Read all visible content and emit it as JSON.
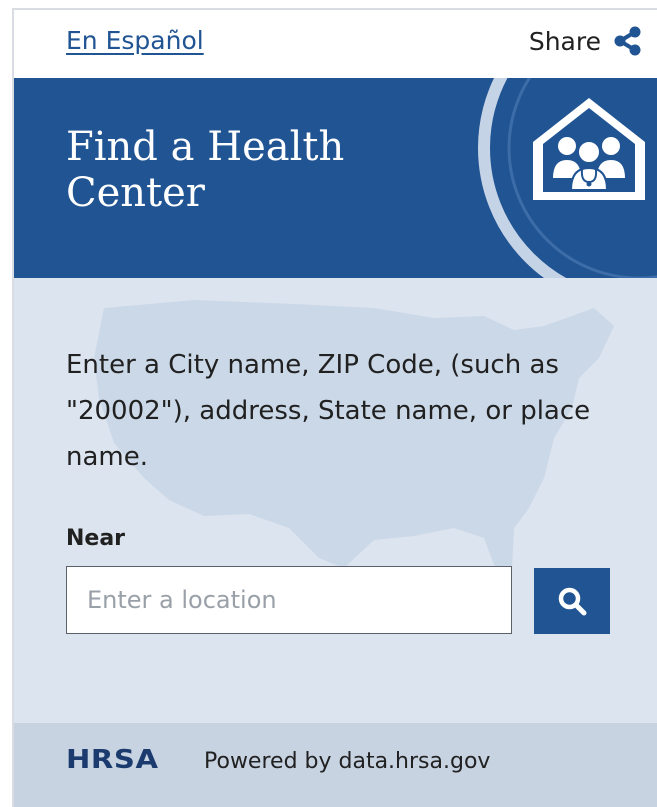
{
  "topbar": {
    "language_link": "En Español",
    "share_label": "Share",
    "share_icon": "share-icon"
  },
  "header": {
    "title": "Find a Health Center",
    "icon": "health-center-house-icon"
  },
  "main": {
    "instructions": "Enter a City name, ZIP Code, (such as \"20002\"), address, State name, or place name.",
    "near_label": "Near",
    "location_placeholder": "Enter a location",
    "location_value": "",
    "search_icon": "search-icon",
    "background_image": "usa-map"
  },
  "footer": {
    "logo_text": "HRSA",
    "powered_by": "Powered by data.hrsa.gov"
  },
  "colors": {
    "brand_blue": "#205493",
    "body_background": "#dce4ef",
    "footer_background": "#c8d3e2",
    "logo_navy": "#1b3b6f"
  }
}
